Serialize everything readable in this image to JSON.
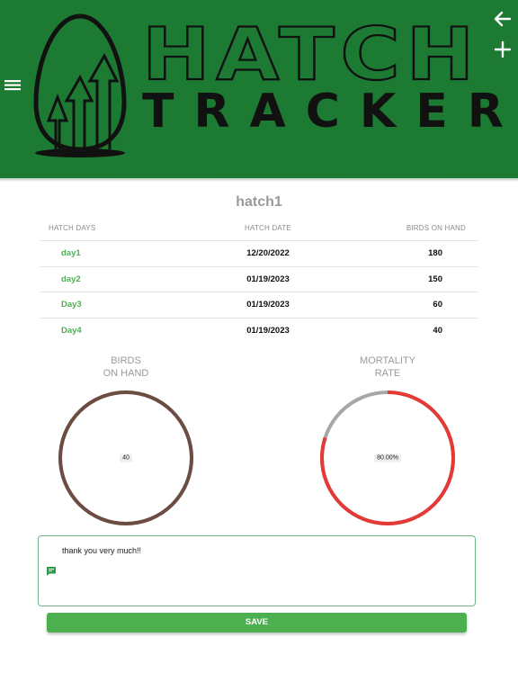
{
  "colors": {
    "header_bg": "#1d7a33",
    "accent_green": "#4caf50",
    "birds_ring": "#6d4c41",
    "mortality_ring": "#e53935",
    "ring_track": "#a7a7a7"
  },
  "header": {
    "logo_text_top": "HATCH",
    "logo_text_bottom": "TRACKER",
    "icons": [
      "menu-icon",
      "back-arrow-icon",
      "plus-icon"
    ]
  },
  "hatch": {
    "title": "hatch1"
  },
  "table": {
    "headers": [
      "HATCH DAYS",
      "HATCH DATE",
      "BIRDS ON HAND"
    ],
    "rows": [
      {
        "day": "day1",
        "date": "12/20/2022",
        "birds": "180"
      },
      {
        "day": "day2",
        "date": "01/19/2023",
        "birds": "150"
      },
      {
        "day": "Day3",
        "date": "01/19/2023",
        "birds": "60"
      },
      {
        "day": "Day4",
        "date": "01/19/2023",
        "birds": "40"
      }
    ]
  },
  "charts": {
    "birds": {
      "title": "BIRDS\nON HAND",
      "center_label": "40",
      "fraction": 1.0
    },
    "mortality": {
      "title": "MORTALITY\nRATE",
      "center_label": "80.00%",
      "fraction": 0.8
    }
  },
  "note": {
    "text": "thank you very much!!"
  },
  "save": {
    "label": "SAVE"
  }
}
